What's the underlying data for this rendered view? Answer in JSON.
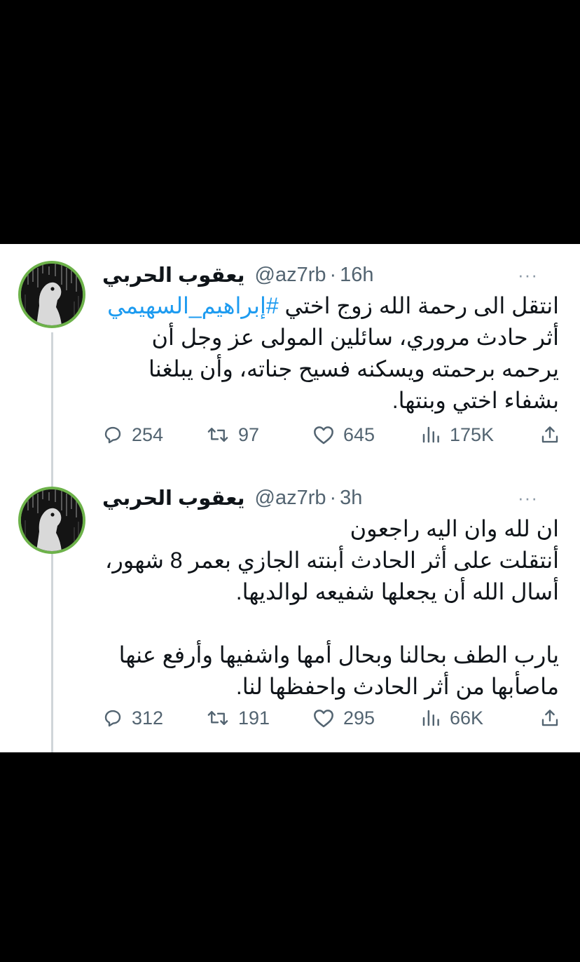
{
  "tweets": [
    {
      "name": "يعقوب الحربي",
      "handle": "@az7rb",
      "separator": "·",
      "time": "16h",
      "more_label": "···",
      "text_before": "انتقل الى رحمة الله زوج اختي ",
      "hashtag": "#إبراهيم_السهيمي",
      "text_after": " أثر حادث مروري، سائلين المولى عز وجل أن يرحمه برحمته ويسكنه فسيح جناته، وأن يبلغنا بشفاء اختي وبنتها.",
      "replies": "254",
      "retweets": "97",
      "likes": "645",
      "views": "175K"
    },
    {
      "name": "يعقوب الحربي",
      "handle": "@az7rb",
      "separator": "·",
      "time": "3h",
      "more_label": "···",
      "lines": [
        "ان لله وان اليه راجعون",
        "أنتقلت على أثر الحادث أبنته الجازي بعمر 8 شهور،",
        "أسال الله أن يجعلها شفيعه لوالديها.",
        "يارب الطف بحالنا وبحال أمها واشفيها وأرفع عنها ماصأبها من أثر الحادث واحفظها لنا."
      ],
      "replies": "312",
      "retweets": "191",
      "likes": "295",
      "views": "66K"
    }
  ],
  "icons": {
    "reply": "reply-icon",
    "retweet": "retweet-icon",
    "like": "heart-icon",
    "views": "views-icon",
    "share": "share-icon",
    "more": "more-icon"
  },
  "colors": {
    "link": "#1d9bf0",
    "text": "#0f1419",
    "secondary": "#536471",
    "avatar_ring": "#6db24a"
  }
}
